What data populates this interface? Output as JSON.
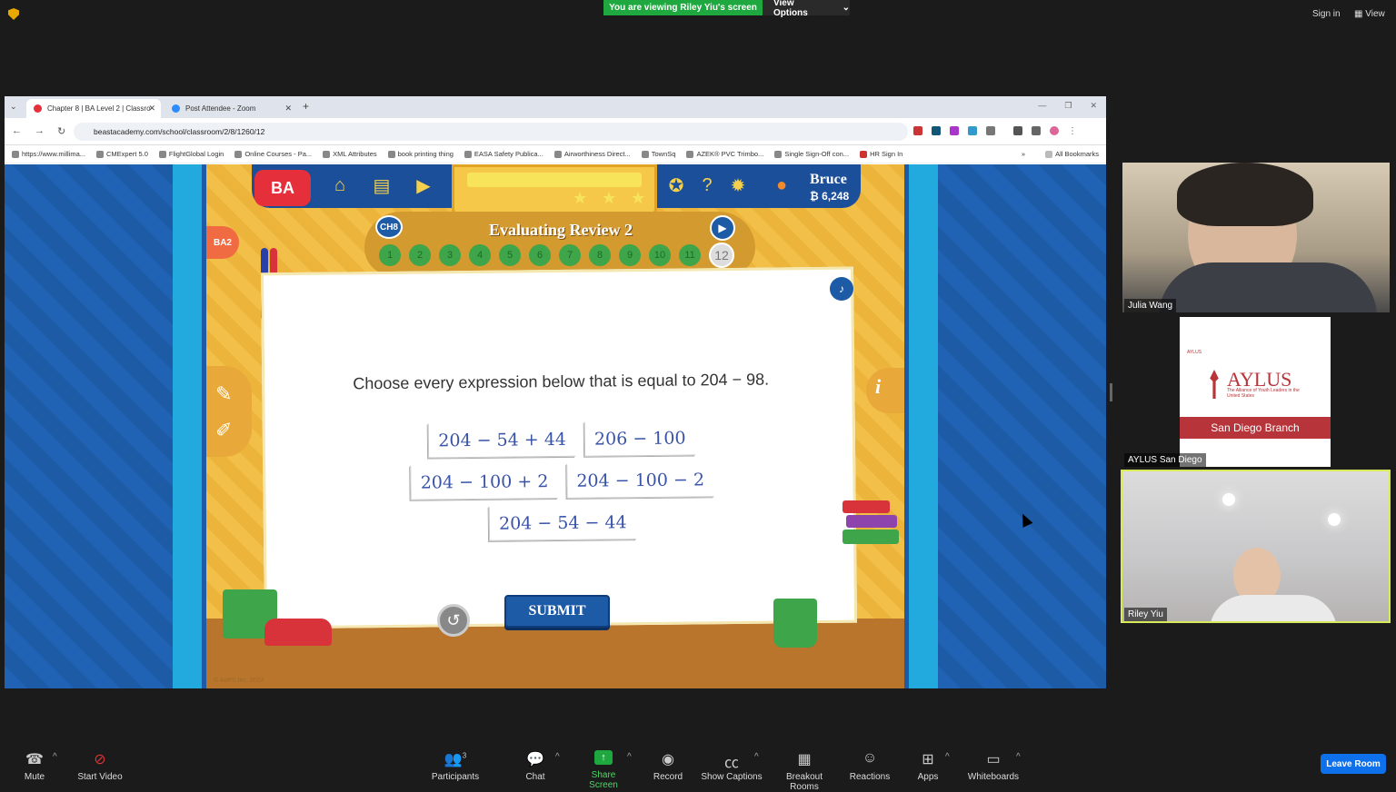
{
  "zoom": {
    "viewing_badge": "You are viewing Riley Yiu's screen",
    "view_options": "View Options",
    "sign_in": "Sign in",
    "view": "View"
  },
  "browser": {
    "tabs": [
      {
        "label": "Chapter 8 | BA Level 2 | Classro"
      },
      {
        "label": "Post Attendee - Zoom"
      }
    ],
    "url": "beastacademy.com/school/classroom/2/8/1260/12",
    "bookmarks": [
      "https://www.millima...",
      "CMExpert 5.0",
      "FlightGlobal Login",
      "Online Courses - Pa...",
      "XML Attributes",
      "book printing thing",
      "EASA Safety Publica...",
      "Airworthiness Direct...",
      "TownSq",
      "AZEK® PVC Trimbo...",
      "Single Sign-Off con...",
      "HR Sign In"
    ],
    "all_bookmarks": "All Bookmarks"
  },
  "game": {
    "logo": "BA",
    "user_name": "Bruce",
    "bucks": "₿ 6,248",
    "chapter_badge": "CH8",
    "lesson_title": "Evaluating Review 2",
    "problem_numbers": [
      "1",
      "2",
      "3",
      "4",
      "5",
      "6",
      "7",
      "8",
      "9",
      "10",
      "11",
      "12"
    ],
    "current_problem": "12",
    "question": "Choose every expression below that is equal to 204 − 98.",
    "choices": [
      "204 − 54 + 44",
      "206 − 100",
      "204 − 100 + 2",
      "204 − 100 − 2",
      "204 − 54 − 44"
    ],
    "submit_label": "SUBMIT",
    "side_badge": "BA2",
    "copyright": "© AoPS Inc. 2024"
  },
  "participants": [
    {
      "name": "Julia Wang"
    },
    {
      "name": "AYLUS San Diego"
    },
    {
      "name": "Riley Yiu"
    }
  ],
  "aylus": {
    "top": "AYLUS",
    "name": "AYLUS",
    "tagline": "The Alliance of Youth Leaders in the United States",
    "branch": "San Diego Branch"
  },
  "toolbar": {
    "mute": "Mute",
    "start_video": "Start Video",
    "participants": "Participants",
    "participant_count": "3",
    "chat": "Chat",
    "share_screen": "Share Screen",
    "record": "Record",
    "show_captions": "Show Captions",
    "breakout_rooms": "Breakout Rooms",
    "reactions": "Reactions",
    "apps": "Apps",
    "whiteboards": "Whiteboards",
    "leave_room": "Leave Room"
  }
}
